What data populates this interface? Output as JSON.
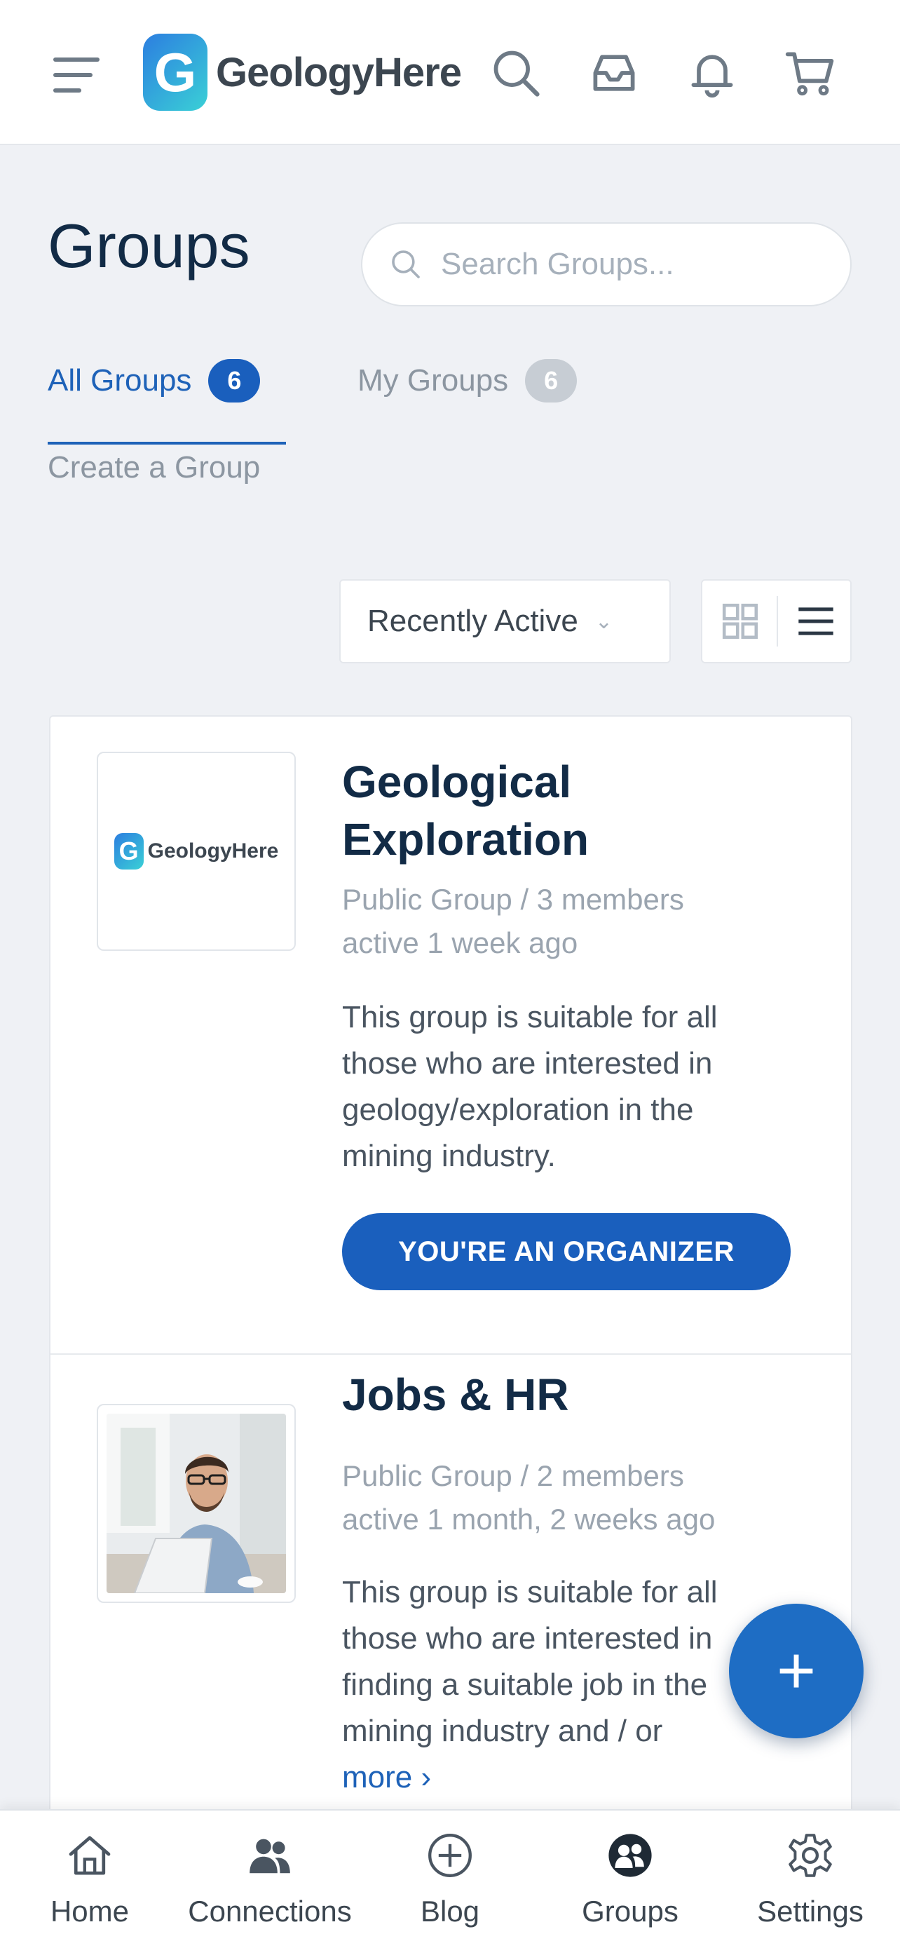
{
  "header": {
    "logo_mark": "G",
    "logo_text": "GeologyHere",
    "icons": [
      "menu-icon",
      "search-icon",
      "inbox-icon",
      "bell-icon",
      "cart-icon"
    ]
  },
  "page": {
    "title": "Groups",
    "search_placeholder": "Search Groups..."
  },
  "tabs": [
    {
      "label": "All Groups",
      "count": "6",
      "active": true
    },
    {
      "label": "My Groups",
      "count": "6",
      "active": false
    }
  ],
  "create_group_label": "Create a Group",
  "filters": {
    "sort_value": "Recently Active",
    "views": [
      "grid-view-icon",
      "list-view-icon"
    ]
  },
  "groups": [
    {
      "name_line1": "Geological",
      "name_line2": "Exploration",
      "avatar_mark": "G",
      "avatar_text": "GeologyHere",
      "meta_line1": "Public Group / 3 members",
      "meta_line2": "active 1 week ago",
      "description": "This group is suitable for all those who are interested in geology/exploration in the mining industry.",
      "button_label": "YOU'RE AN ORGANIZER"
    },
    {
      "name_line1": "Jobs & HR",
      "meta_line1": "Public Group / 2 members",
      "meta_line2": "active 1 month, 2 weeks ago",
      "description": "This group is suitable for all those who are interested in finding a suitable job in the mining industry and / or",
      "more_label": "more ›"
    }
  ],
  "fab_label": "+",
  "bottom_nav": [
    {
      "label": "Home",
      "icon": "home-icon"
    },
    {
      "label": "Connections",
      "icon": "connections-icon"
    },
    {
      "label": "Blog",
      "icon": "blog-plus-icon"
    },
    {
      "label": "Groups",
      "icon": "groups-icon"
    },
    {
      "label": "Settings",
      "icon": "settings-gear-icon"
    }
  ],
  "colors": {
    "accent": "#1a5fbd",
    "background": "#eff1f5",
    "text_primary": "#122b46",
    "text_muted": "#9aa4af"
  }
}
